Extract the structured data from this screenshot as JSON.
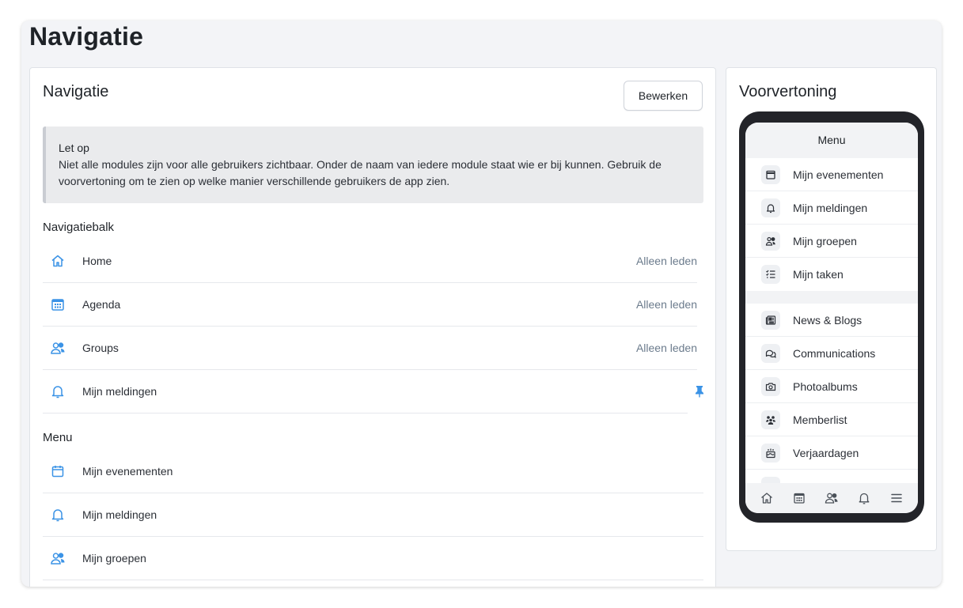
{
  "page": {
    "title": "Navigatie"
  },
  "main": {
    "title": "Navigatie",
    "edit_label": "Bewerken",
    "notice": {
      "title": "Let op",
      "body": "Niet alle modules zijn voor alle gebruikers zichtbaar. Onder de naam van iedere module staat wie er bij kunnen. Gebruik de voorvertoning om te zien op welke manier verschillende gebruikers de app zien."
    },
    "navbar_label": "Navigatiebalk",
    "navbar_items": [
      {
        "label": "Home",
        "icon": "home-icon",
        "audience": "Alleen leden"
      },
      {
        "label": "Agenda",
        "icon": "calendar-icon",
        "audience": "Alleen leden"
      },
      {
        "label": "Groups",
        "icon": "users-icon",
        "audience": "Alleen leden"
      },
      {
        "label": "Mijn meldingen",
        "icon": "bell-icon",
        "pinned": true
      }
    ],
    "menu_label": "Menu",
    "menu_items": [
      {
        "label": "Mijn evenementen",
        "icon": "calendar-icon"
      },
      {
        "label": "Mijn meldingen",
        "icon": "bell-icon"
      },
      {
        "label": "Mijn groepen",
        "icon": "users-icon"
      }
    ],
    "accent_color": "#3b93e6"
  },
  "preview": {
    "title": "Voorvertoning",
    "menu_title": "Menu",
    "group1": [
      {
        "label": "Mijn evenementen",
        "icon": "calendar-icon"
      },
      {
        "label": "Mijn meldingen",
        "icon": "bell-icon"
      },
      {
        "label": "Mijn groepen",
        "icon": "users-icon"
      },
      {
        "label": "Mijn taken",
        "icon": "checklist-icon"
      }
    ],
    "group2": [
      {
        "label": "News & Blogs",
        "icon": "newspaper-icon"
      },
      {
        "label": "Communications",
        "icon": "chat-icon"
      },
      {
        "label": "Photoalbums",
        "icon": "camera-icon"
      },
      {
        "label": "Memberlist",
        "icon": "members-icon"
      },
      {
        "label": "Verjaardagen",
        "icon": "cake-icon"
      }
    ],
    "tabbar": [
      "home-icon",
      "calendar-icon",
      "users-icon",
      "bell-icon",
      "menu-icon"
    ]
  }
}
